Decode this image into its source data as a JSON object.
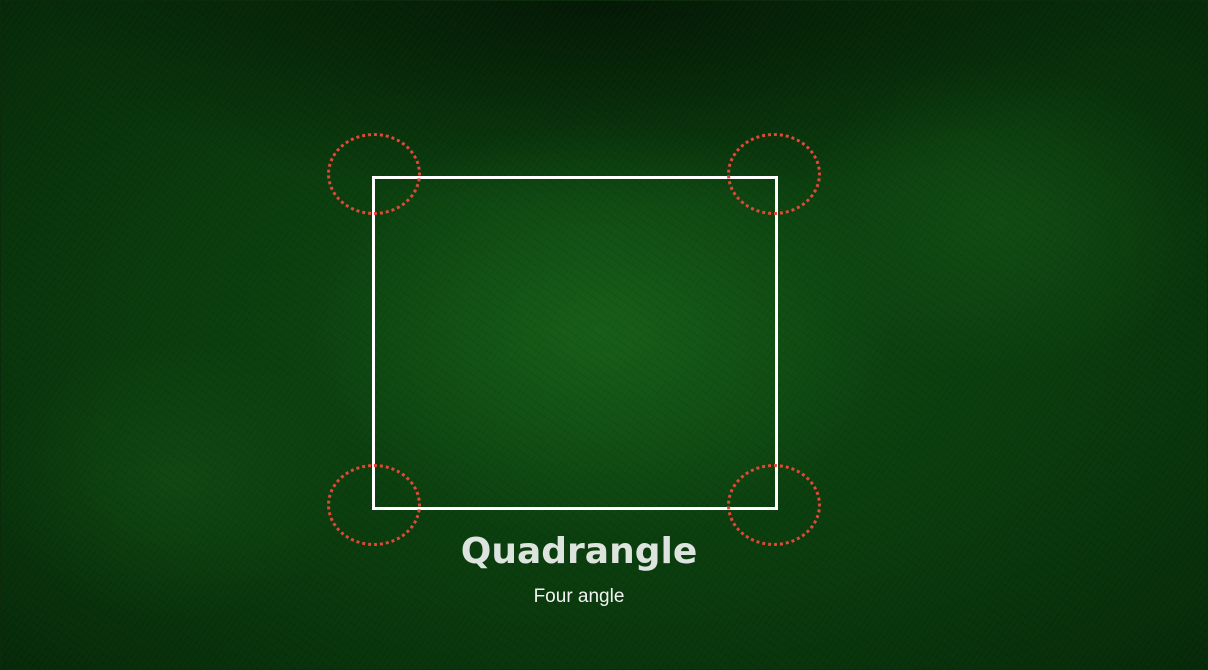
{
  "slide": {
    "title": "Quadrangle",
    "subtitle": "Four angle"
  },
  "colors": {
    "background": "#0a3a0d",
    "shape_outline": "#ffffff",
    "corner_markers": "#e0493a",
    "title_text": "#dde3dd",
    "subtitle_text": "#f2f2f2"
  }
}
